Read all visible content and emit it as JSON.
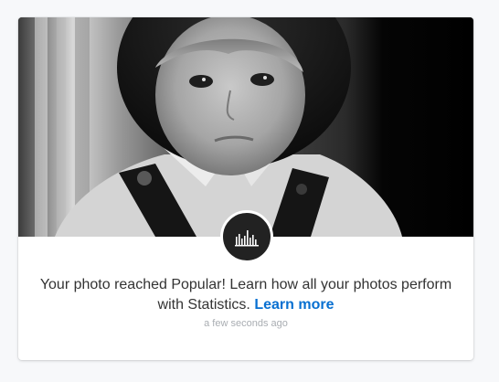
{
  "notification": {
    "message_line1": "Your photo reached Popular! Learn how all your photos perform",
    "message_line2": "with Statistics.",
    "link_text": "Learn more",
    "timestamp": "a few seconds ago",
    "badge_icon": "statistics-bars-icon",
    "photo_icon": "black-and-white-portrait-photo"
  },
  "colors": {
    "link": "#0870d1",
    "text": "#333333",
    "timestamp": "#a9adb2",
    "badge_bg": "#222222"
  }
}
